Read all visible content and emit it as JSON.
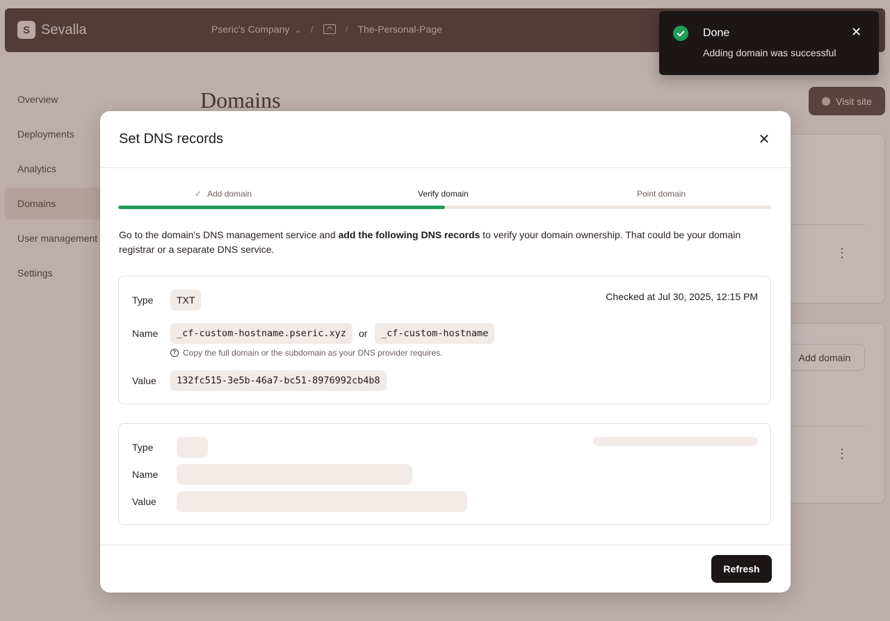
{
  "app": {
    "name": "Sevalla",
    "logo_glyph": "S"
  },
  "breadcrumb": {
    "company": "Pseric's Company",
    "separator": "/",
    "project": "The-Personal-Page"
  },
  "sidebar": {
    "items": [
      {
        "label": "Overview"
      },
      {
        "label": "Deployments"
      },
      {
        "label": "Analytics"
      },
      {
        "label": "Domains"
      },
      {
        "label": "User management"
      },
      {
        "label": "Settings"
      }
    ],
    "active": "Domains"
  },
  "page": {
    "title": "Domains",
    "visit_site_label": "Visit site",
    "add_domain_label": "Add domain",
    "menu_glyph": "⋮"
  },
  "modal": {
    "title": "Set DNS records",
    "close_glyph": "✕",
    "steps": [
      {
        "label": "Add domain",
        "state": "done",
        "check_glyph": "✓"
      },
      {
        "label": "Verify domain",
        "state": "current"
      },
      {
        "label": "Point domain",
        "state": "pending"
      }
    ],
    "progress_fraction": 0.5,
    "intro_before": "Go to the domain's DNS management service and ",
    "intro_bold": "add the following DNS records",
    "intro_after": " to verify your domain ownership. That could be your domain registrar or a separate DNS service.",
    "record": {
      "type_label": "Type",
      "type_value": "TXT",
      "checked_at": "Checked at Jul 30, 2025, 12:15 PM",
      "name_label": "Name",
      "name_full": "_cf-custom-hostname.pseric.xyz",
      "or_text": "or",
      "name_short": "_cf-custom-hostname",
      "hint": "Copy the full domain or the subdomain as your DNS provider requires.",
      "value_label": "Value",
      "value": "132fc515-3e5b-46a7-bc51-8976992cb4b8"
    },
    "loading_record": {
      "type_label": "Type",
      "name_label": "Name",
      "value_label": "Value"
    },
    "refresh_label": "Refresh"
  },
  "toast": {
    "title": "Done",
    "message": "Adding domain was successful",
    "close_glyph": "✕",
    "status_color": "#1e9e58"
  },
  "icons": {
    "brand": "sevalla-logo-icon",
    "chevron": "chevron-down-icon",
    "project": "project-icon",
    "globe": "globe-icon",
    "help": "help-circle-icon",
    "success": "check-circle-icon"
  },
  "colors": {
    "accent_progress": "#1f9a57",
    "topbar": "#3d2e2c",
    "primary_button": "#1c1716"
  }
}
